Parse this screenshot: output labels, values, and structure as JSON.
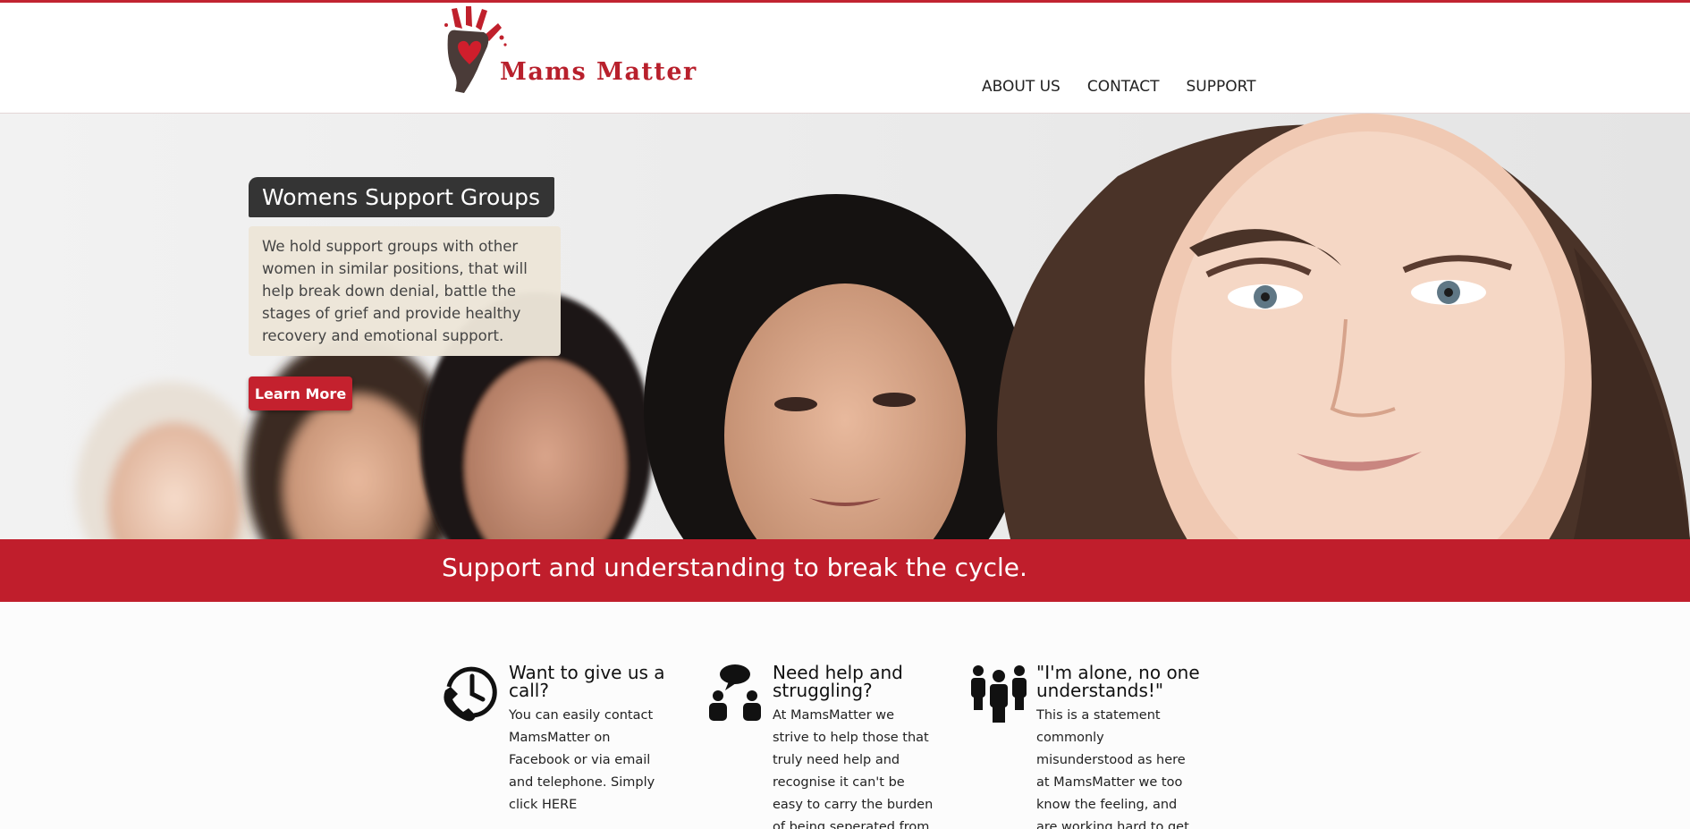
{
  "brand": {
    "name": "Mams  Matter",
    "accent_color": "#c01e2c",
    "logo_icon": "hand-heart-logo"
  },
  "nav": {
    "items": [
      {
        "label": "ABOUT US"
      },
      {
        "label": "CONTACT"
      },
      {
        "label": "SUPPORT"
      }
    ]
  },
  "hero": {
    "title": "Womens Support Groups",
    "description": "We hold support groups with other women in similar positions, that will help break down denial, battle the stages of grief and provide healthy recovery and emotional support.",
    "button_label": "Learn More",
    "image_subject": "women-faces-photo"
  },
  "banner": {
    "text": "Support and understanding to break the cycle."
  },
  "features": [
    {
      "icon": "phone-clock-icon",
      "title": "Want to give us a call?",
      "text": "You can easily contact MamsMatter on Facebook or via email and telephone. Simply click HERE"
    },
    {
      "icon": "people-talking-icon",
      "title": "Need help and struggling?",
      "text": "At MamsMatter we strive to help those that truly need help and recognise it can't be easy to carry the burden of being seperated from loved ones. The"
    },
    {
      "icon": "group-people-icon",
      "title": "\"I'm alone, no one understands!\"",
      "text": "This is a statement commonly misunderstood as here at MamsMatter we too know the feeling, and are working hard to get support for mothers and"
    }
  ]
}
